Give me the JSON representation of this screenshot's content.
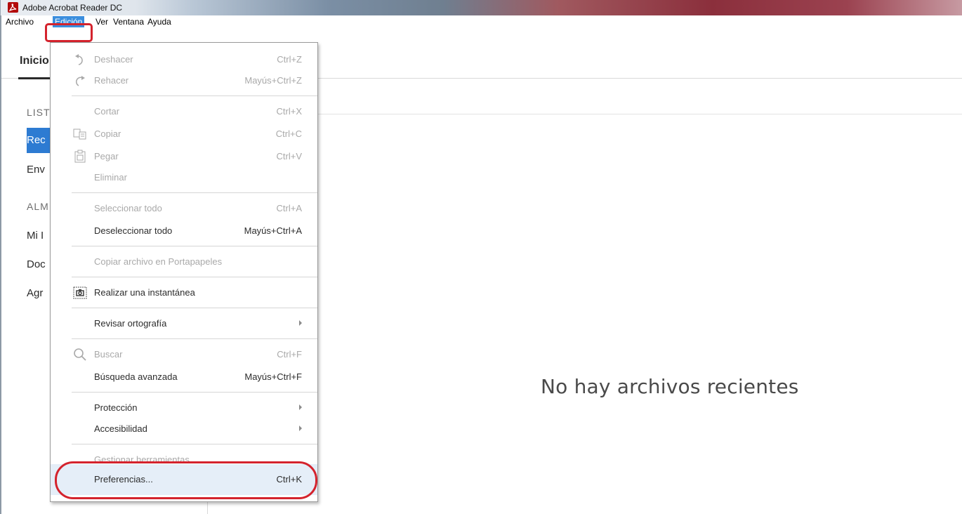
{
  "window": {
    "title": "Adobe Acrobat Reader DC"
  },
  "menubar": {
    "items": [
      {
        "label": "Archivo"
      },
      {
        "label": "Edición"
      },
      {
        "label": "Ver"
      },
      {
        "label": "Ventana"
      },
      {
        "label": "Ayuda"
      }
    ],
    "active": "Edición"
  },
  "tabs": {
    "home": "Inicio"
  },
  "sidebar": {
    "section1": "LIST",
    "item_rec": "Rec",
    "item_env": "Env",
    "section2": "ALM",
    "item_mi": "Mi I",
    "item_doc": "Doc",
    "item_agr": "Agr"
  },
  "main": {
    "empty_message": "No hay archivos recientes"
  },
  "edit_menu": {
    "undo": {
      "label": "Deshacer",
      "shortcut": "Ctrl+Z",
      "icon": "undo-icon"
    },
    "redo": {
      "label": "Rehacer",
      "shortcut": "Mayús+Ctrl+Z",
      "icon": "redo-icon"
    },
    "cut": {
      "label": "Cortar",
      "shortcut": "Ctrl+X"
    },
    "copy": {
      "label": "Copiar",
      "shortcut": "Ctrl+C",
      "icon": "copy-icon"
    },
    "paste": {
      "label": "Pegar",
      "shortcut": "Ctrl+V",
      "icon": "paste-icon"
    },
    "delete": {
      "label": "Eliminar"
    },
    "select_all": {
      "label": "Seleccionar todo",
      "shortcut": "Ctrl+A"
    },
    "deselect_all": {
      "label": "Deseleccionar todo",
      "shortcut": "Mayús+Ctrl+A"
    },
    "copy_file": {
      "label": "Copiar archivo en Portapapeles"
    },
    "snapshot": {
      "label": "Realizar una instantánea",
      "icon": "camera-icon"
    },
    "spelling": {
      "label": "Revisar ortografía"
    },
    "find": {
      "label": "Buscar",
      "shortcut": "Ctrl+F",
      "icon": "search-icon"
    },
    "advanced_search": {
      "label": "Búsqueda avanzada",
      "shortcut": "Mayús+Ctrl+F"
    },
    "protection": {
      "label": "Protección"
    },
    "accessibility": {
      "label": "Accesibilidad"
    },
    "manage_tools": {
      "label": "Gestionar herramientas"
    },
    "preferences": {
      "label": "Preferencias...",
      "shortcut": "Ctrl+K"
    }
  },
  "colors": {
    "highlight_red": "#d4232d",
    "selection_blue": "#2d7bd2",
    "menu_active": "#3b8ede"
  }
}
